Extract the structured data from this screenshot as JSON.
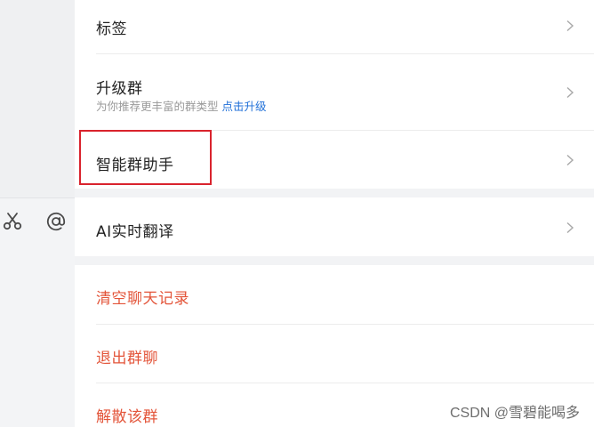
{
  "settings": {
    "items": [
      {
        "label": "标签"
      },
      {
        "label": "升级群",
        "sub": "为你推荐更丰富的群类型",
        "link": "点击升级"
      },
      {
        "label": "智能群助手"
      },
      {
        "label": "AI实时翻译"
      }
    ],
    "danger_items": [
      {
        "label": "清空聊天记录"
      },
      {
        "label": "退出群聊"
      },
      {
        "label": "解散该群"
      }
    ]
  },
  "toolbar": {
    "icons": [
      "scissors-icon",
      "at-icon"
    ]
  },
  "watermark": "CSDN @雪碧能喝多",
  "colors": {
    "danger": "#e3553a",
    "link": "#1f6fd8",
    "highlight": "#d9232d",
    "divider": "#f2f3f5"
  }
}
